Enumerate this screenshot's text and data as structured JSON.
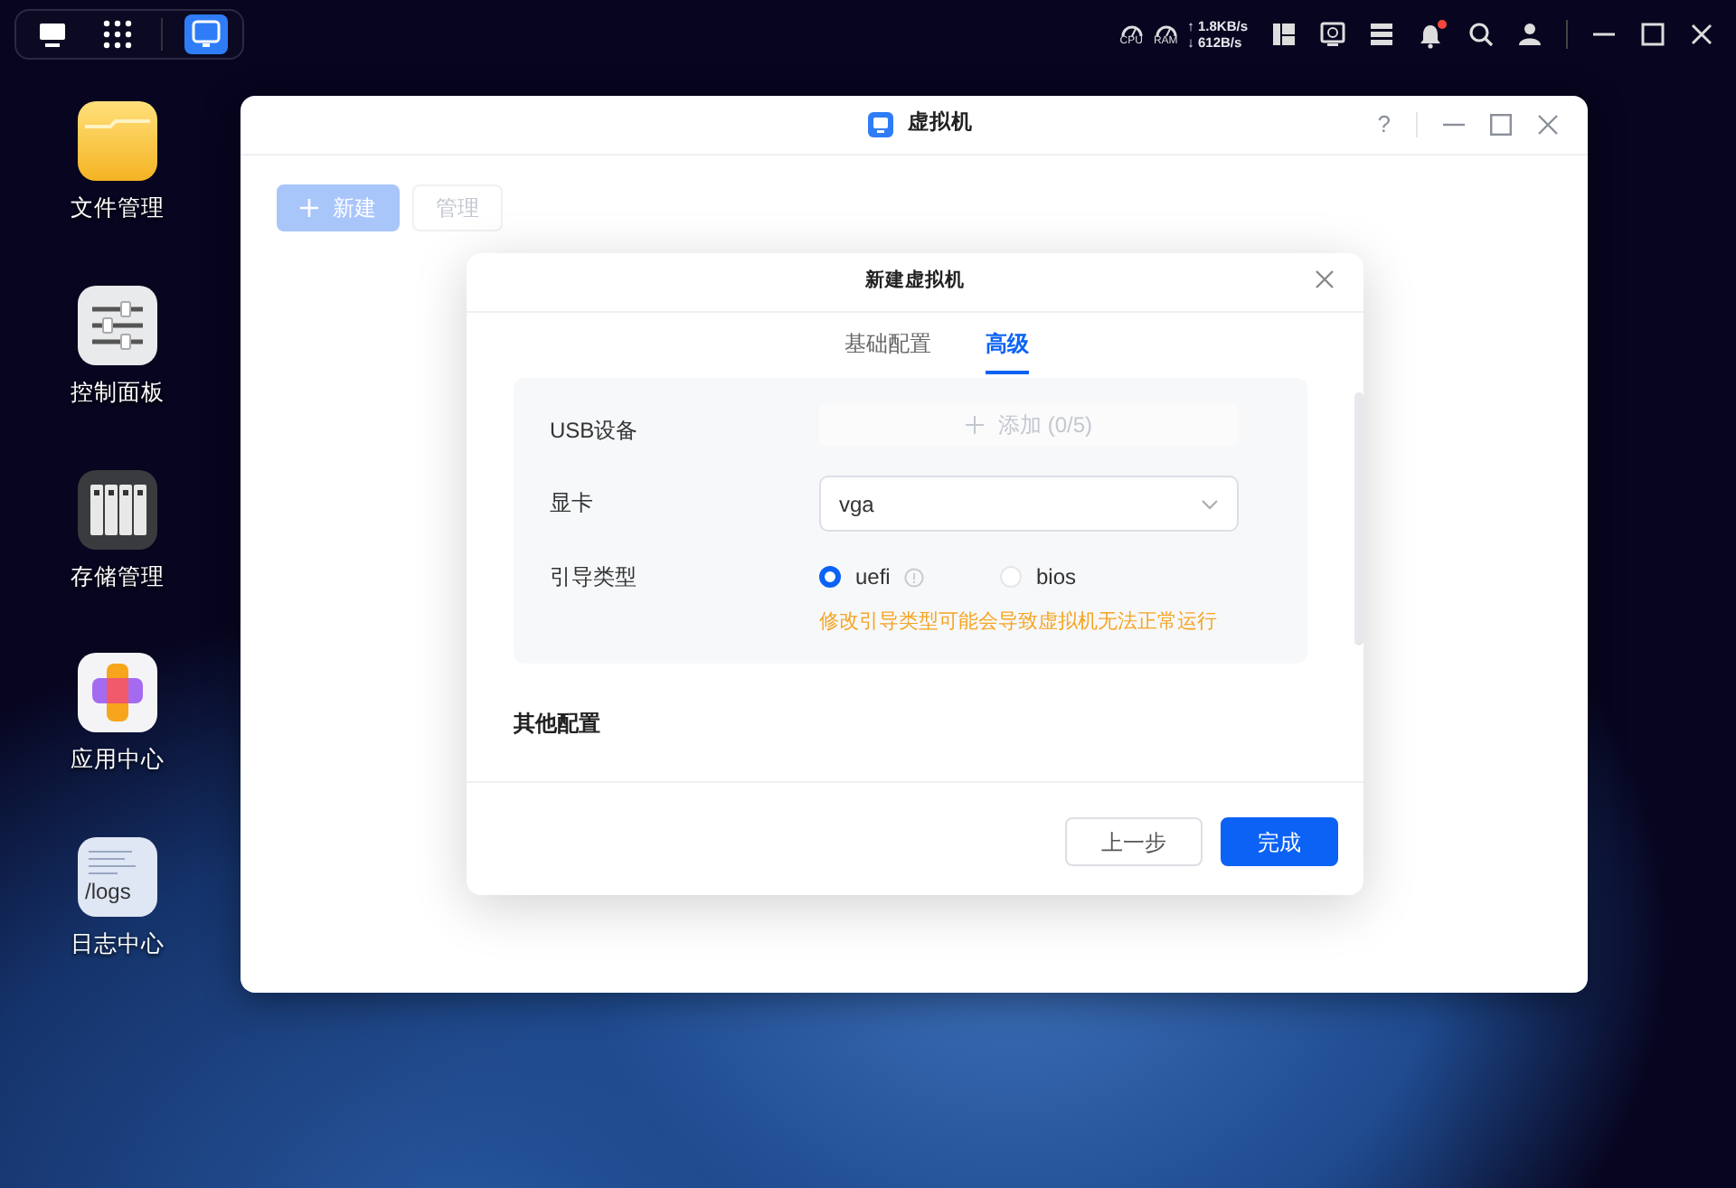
{
  "taskbar": {
    "items": [
      {
        "kind": "desktop",
        "selected": false
      },
      {
        "kind": "apps",
        "selected": false
      },
      {
        "kind": "vm",
        "selected": true
      }
    ]
  },
  "system_tray": {
    "cpu_label": "CPU",
    "ram_label": "RAM",
    "upload_arrow": "↑",
    "upload": "1.8KB/s",
    "download_arrow": "↓",
    "download": "612B/s",
    "notification_badge": true
  },
  "desktop_icons": [
    {
      "kind": "files",
      "label": "文件管理"
    },
    {
      "kind": "control",
      "label": "控制面板"
    },
    {
      "kind": "storage",
      "label": "存储管理"
    },
    {
      "kind": "appcenter",
      "label": "应用中心"
    },
    {
      "kind": "logs",
      "label": "日志中心",
      "icon_text": "/logs"
    }
  ],
  "window": {
    "title": "虚拟机",
    "help": "?",
    "toolbar": [
      {
        "kind": "primary",
        "label": "新建",
        "disabled": true
      },
      {
        "kind": "secondary",
        "label": "管理",
        "disabled": true
      }
    ]
  },
  "dialog": {
    "title": "新建虚拟机",
    "tabs": [
      {
        "label": "基础配置",
        "selected": false
      },
      {
        "label": "高级",
        "selected": true
      }
    ],
    "fields": [
      {
        "kind": "add",
        "label": "USB设备",
        "button": "添加 (0/5)",
        "disabled": true
      },
      {
        "kind": "select",
        "label": "显卡",
        "value": "vga"
      },
      {
        "kind": "radio",
        "label": "引导类型",
        "options": [
          {
            "label": "uefi",
            "selected": true,
            "info": true
          },
          {
            "label": "bios",
            "selected": false,
            "info": false
          }
        ],
        "warning": "修改引导类型可能会导致虚拟机无法正常运行"
      }
    ],
    "section_title": "其他配置",
    "buttons": [
      {
        "kind": "secondary",
        "label": "上一步"
      },
      {
        "kind": "primary",
        "label": "完成"
      }
    ]
  }
}
